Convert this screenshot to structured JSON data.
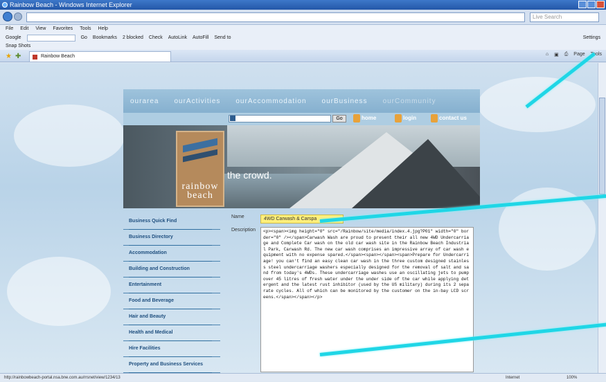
{
  "browser": {
    "title": "Rainbow Beach - Windows Internet Explorer",
    "search_placeholder": "Live Search",
    "menu": [
      "File",
      "Edit",
      "View",
      "Favorites",
      "Tools",
      "Help"
    ],
    "google_label": "Google",
    "google_items": [
      "Go",
      "Bookmarks",
      "2 blocked",
      "Check",
      "AutoLink",
      "AutoFill",
      "Send to"
    ],
    "google_settings": "Settings",
    "snap_label": "Snap Shots",
    "tab_label": "Rainbow Beach",
    "cmd_items": [
      "Page",
      "Tools"
    ],
    "status_url": "http://rainbowbeach-portal.nsa.bne.com.au/rrsnet/view/1234/13",
    "status_zone": "Internet",
    "status_zoom": "100%"
  },
  "site": {
    "nav": [
      "ourarea",
      "ourActivities",
      "ourAccommodation",
      "ourBusiness",
      "ourCommunity"
    ],
    "search_go": "Go",
    "links": [
      "home",
      "login",
      "contact us"
    ],
    "logo_text_1": "rainbow",
    "logo_text_2": "beach",
    "tagline": "the crowd.",
    "sidebar": [
      "Business Quick Find",
      "Business Directory",
      "Accommodation",
      "Building and Construction",
      "Entertainment",
      "Food and Beverage",
      "Hair and Beauty",
      "Health and Medical",
      "Hire Facilities",
      "Property and Business Services"
    ],
    "form": {
      "name_label": "Name",
      "name_value": "4WD Carwash & Carspa",
      "description_label": "Description",
      "description_value": "<p><span><img height=\"0\" src=\"/Rainbow/site/media/index.4.jpg?P01\" width=\"0\" border=\"0\" /></span>Carwash Wash are proud to present their all new 4WD Undercarriage and Complete Car wash on the old car wash site in the Rainbow Beach Industrial Park, Carwash Rd. The new car wash comprises an impressive array of car wash equipment with no expense spared.</span><span></span><span>Prepare for Undercarriage! you can't find an easy clean car wash in the three custom designed stainless steel undercarriage washers especially designed for the removal of salt and sand from today's 4WDs. These undercarriage washes use an oscillating jets to pump over 45 litres of fresh water under the under side of the car while applying detergent and the latest rust inhibitor (used by the US military) during its 2 separate cycles. All of which can be monitored by the customer on the in-bay LCD screens.</span></span></p>"
    }
  },
  "colors": {
    "beam": "#1fd6e6",
    "name_highlight": "#ffef7a",
    "nav_bg": "#9ec3dc"
  }
}
